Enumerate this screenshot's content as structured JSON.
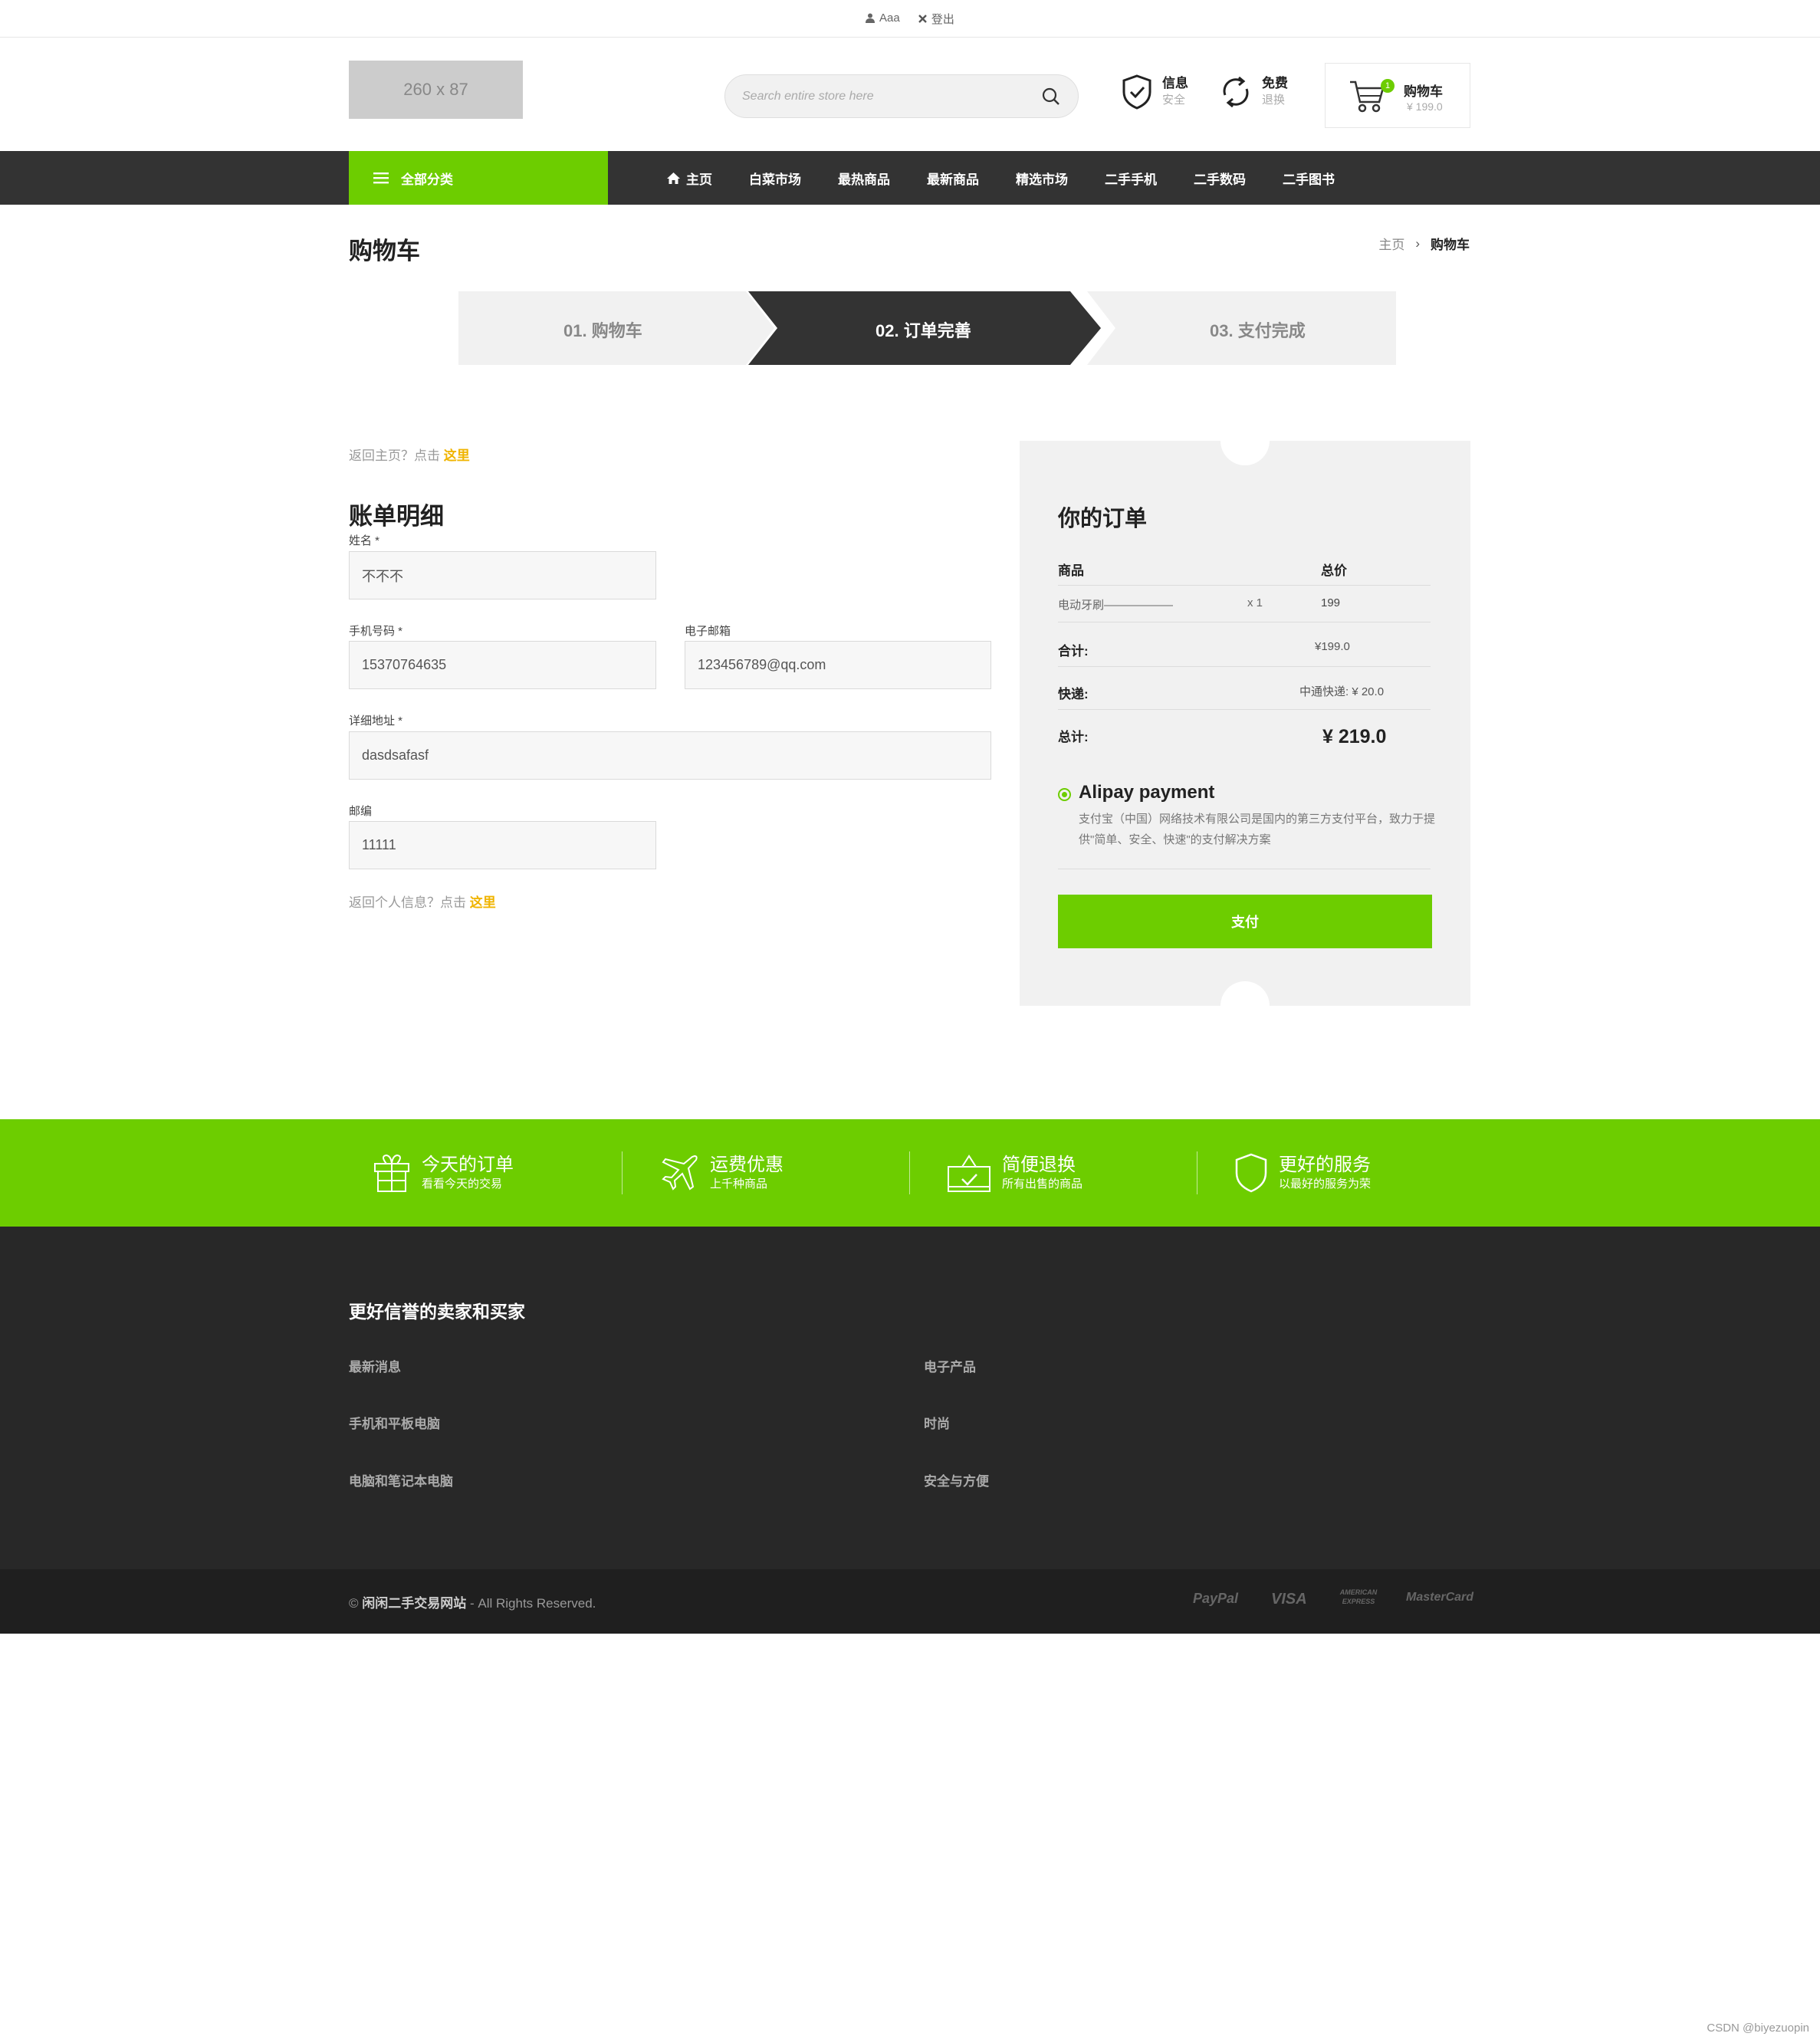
{
  "topbar": {
    "user": "Aaa",
    "logout": "登出"
  },
  "header": {
    "logo_text": "260 x 87",
    "search_placeholder": "Search entire store here",
    "feature1": {
      "title": "信息",
      "sub": "安全"
    },
    "feature2": {
      "title": "免费",
      "sub": "退换"
    },
    "cart": {
      "count": "1",
      "title": "购物车",
      "price": "¥ 199.0"
    }
  },
  "nav": {
    "all_categories": "全部分类",
    "items": [
      "主页",
      "白菜市场",
      "最热商品",
      "最新商品",
      "精选市场",
      "二手手机",
      "二手数码",
      "二手图书"
    ]
  },
  "page": {
    "title": "购物车",
    "breadcrumb_home": "主页",
    "breadcrumb_current": "购物车"
  },
  "steps": [
    "01. 购物车",
    "02. 订单完善",
    "03. 支付完成"
  ],
  "billing": {
    "back_home_prefix": "返回主页？点击",
    "back_home_link": "这里",
    "title": "账单明细",
    "name_label": "姓名 *",
    "name_value": "不不不",
    "phone_label": "手机号码 *",
    "phone_value": "15370764635",
    "email_label": "电子邮箱",
    "email_value": "123456789@qq.com",
    "address_label": "详细地址 *",
    "address_value": "dasdsafasf",
    "zip_label": "邮编",
    "zip_value": "11111",
    "back_info_prefix": "返回个人信息？点击",
    "back_info_link": "这里"
  },
  "order": {
    "title": "你的订单",
    "col_product": "商品",
    "col_total": "总价",
    "item_name": "电动牙刷——————",
    "item_qty": "x 1",
    "item_price": "199",
    "subtotal_label": "合计:",
    "subtotal_value": "¥199.0",
    "shipping_label": "快递:",
    "shipping_value": "中通快递: ¥ 20.0",
    "total_label": "总计:",
    "total_value": "¥ 219.0",
    "payment_title": "Alipay payment",
    "payment_desc": "支付宝（中国）网络技术有限公司是国内的第三方支付平台，致力于提供\"简单、安全、快速\"的支付解决方案",
    "pay_button": "支付"
  },
  "features": [
    {
      "title": "今天的订单",
      "sub": "看看今天的交易"
    },
    {
      "title": "运费优惠",
      "sub": "上千种商品"
    },
    {
      "title": "简便退换",
      "sub": "所有出售的商品"
    },
    {
      "title": "更好的服务",
      "sub": "以最好的服务为荣"
    }
  ],
  "footer": {
    "heading": "更好信誉的卖家和买家",
    "links_left": [
      "最新消息",
      "手机和平板电脑",
      "电脑和笔记本电脑"
    ],
    "links_right": [
      "电子产品",
      "时尚",
      "安全与方便"
    ],
    "copyright_prefix": "©",
    "copyright_site": "闲闲二手交易网站",
    "copyright_suffix": "- All Rights Reserved.",
    "payments": [
      "PayPal",
      "VISA",
      "AMERICAN EXPRESS",
      "MasterCard"
    ]
  },
  "watermark": "CSDN @biyezuopin",
  "colors": {
    "accent": "#6dcd00",
    "dark": "#333333",
    "footer": "#282828",
    "link": "#f0b400"
  }
}
